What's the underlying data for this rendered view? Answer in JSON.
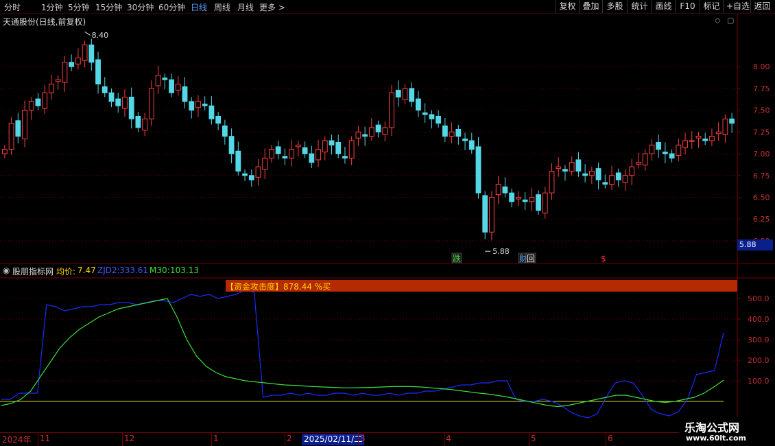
{
  "toolbar": {
    "periods": [
      "分时",
      "1分钟",
      "5分钟",
      "15分钟",
      "30分钟",
      "60分钟",
      "日线",
      "周线",
      "月线",
      "更多 >"
    ],
    "active_period": "日线",
    "buttons": [
      "复权",
      "叠加",
      "多股",
      "统计",
      "画线",
      "F10",
      "标记",
      "+自选",
      "返回"
    ]
  },
  "main_panel": {
    "title": "天通股份(日线,前复权)",
    "price_axis": [
      "8.00",
      "7.75",
      "7.50",
      "7.25",
      "7.00",
      "6.75",
      "6.50",
      "6.25",
      "6.00"
    ],
    "high_label": "8.40",
    "low_label": "5.88",
    "current_price_tag": "5.88",
    "markers": [
      {
        "text": "跌",
        "color": "#4ade4a"
      },
      {
        "text": "财",
        "color": "#5aa0ff"
      },
      {
        "text": "回",
        "color": "#ffffff"
      },
      {
        "text": "$",
        "color": "#ff3030"
      }
    ]
  },
  "indicator_panel": {
    "name": "股朋指标网",
    "avg_label": "均价:",
    "avg_value": "7.47",
    "zjd2_label": "ZJD2:",
    "zjd2_value": "333.61",
    "m30_label": "M30:",
    "m30_value": "103.13",
    "signal_text": "【资金攻击度】878.44 %买",
    "y_axis": [
      "500.0",
      "400.0",
      "300.0",
      "200.0",
      "100.0"
    ]
  },
  "date_axis": {
    "year": "2024年",
    "months": [
      "11",
      "12",
      "1",
      "2",
      "3",
      "4",
      "5",
      "6"
    ],
    "cursor_date": "2025/02/11/二"
  },
  "watermark": {
    "title": "乐淘公式网",
    "url": "www.60lt.com"
  },
  "colors": {
    "up": "#ff4040",
    "down": "#54d8e8",
    "zjd2": "#1a2cff",
    "m30": "#3ce03c",
    "baseline": "#d8d820",
    "grid": "#7a0000",
    "axis_text": "#c83030"
  },
  "chart_data": [
    {
      "type": "candlestick",
      "title": "天通股份(日线,前复权)",
      "ylim": [
        5.88,
        8.4
      ],
      "y_ticks": [
        6.0,
        6.25,
        6.5,
        6.75,
        7.0,
        7.25,
        7.5,
        7.75,
        8.0
      ],
      "x_months": [
        "11",
        "12",
        "1",
        "2",
        "3",
        "4",
        "5",
        "6"
      ],
      "close_series": [
        7.05,
        7.35,
        7.2,
        7.5,
        7.6,
        7.55,
        7.7,
        7.8,
        7.85,
        8.05,
        8.0,
        8.1,
        8.25,
        8.05,
        7.8,
        7.7,
        7.6,
        7.55,
        7.65,
        7.4,
        7.3,
        7.4,
        7.75,
        7.9,
        7.85,
        7.7,
        7.8,
        7.6,
        7.5,
        7.6,
        7.55,
        7.4,
        7.35,
        7.2,
        7.0,
        6.8,
        6.75,
        6.7,
        6.85,
        6.95,
        7.05,
        7.0,
        6.95,
        7.05,
        7.1,
        7.0,
        6.9,
        7.05,
        7.15,
        7.1,
        7.0,
        6.95,
        7.15,
        7.25,
        7.2,
        7.3,
        7.25,
        7.3,
        7.7,
        7.65,
        7.75,
        7.6,
        7.5,
        7.45,
        7.4,
        7.35,
        7.2,
        7.25,
        7.2,
        7.15,
        7.05,
        6.55,
        6.1,
        6.5,
        6.65,
        6.55,
        6.45,
        6.5,
        6.45,
        6.5,
        6.35,
        6.55,
        6.8,
        6.85,
        6.8,
        6.9,
        6.8,
        6.75,
        6.8,
        6.7,
        6.65,
        6.75,
        6.7,
        6.75,
        6.85,
        6.9,
        7.0,
        7.1,
        7.05,
        7.0,
        6.95,
        7.1,
        7.15,
        7.15,
        7.2,
        7.15,
        7.2,
        7.25,
        7.4,
        7.35
      ]
    },
    {
      "type": "line",
      "title": "股朋指标网",
      "ylim": [
        -100,
        600
      ],
      "y_ticks": [
        100,
        200,
        300,
        400,
        500
      ],
      "series": [
        {
          "name": "ZJD2",
          "values": [
            10,
            10,
            40,
            40,
            40,
            470,
            460,
            440,
            450,
            460,
            460,
            470,
            470,
            480,
            480,
            470,
            480,
            490,
            490,
            480,
            500,
            520,
            510,
            520,
            500,
            510,
            520,
            540,
            530,
            20,
            30,
            30,
            40,
            30,
            40,
            30,
            30,
            40,
            40,
            30,
            40,
            30,
            30,
            40,
            30,
            40,
            40,
            50,
            50,
            60,
            70,
            80,
            80,
            90,
            90,
            100,
            100,
            10,
            0,
            0,
            10,
            0,
            -20,
            -50,
            -70,
            -80,
            -60,
            20,
            90,
            100,
            90,
            30,
            -40,
            -60,
            -70,
            -50,
            10,
            130,
            140,
            150,
            333.61
          ]
        },
        {
          "name": "M30",
          "values": [
            -20,
            -10,
            10,
            50,
            120,
            190,
            260,
            310,
            350,
            380,
            410,
            430,
            450,
            460,
            470,
            480,
            490,
            500,
            410,
            300,
            220,
            170,
            140,
            120,
            110,
            100,
            95,
            90,
            85,
            80,
            78,
            75,
            72,
            70,
            68,
            66,
            66,
            67,
            68,
            70,
            72,
            73,
            72,
            70,
            66,
            62,
            58,
            52,
            46,
            40,
            35,
            28,
            20,
            10,
            0,
            -10,
            -20,
            -25,
            -20,
            -10,
            0,
            10,
            20,
            30,
            30,
            20,
            10,
            0,
            -5,
            0,
            10,
            20,
            40,
            70,
            103.13
          ]
        }
      ]
    }
  ]
}
